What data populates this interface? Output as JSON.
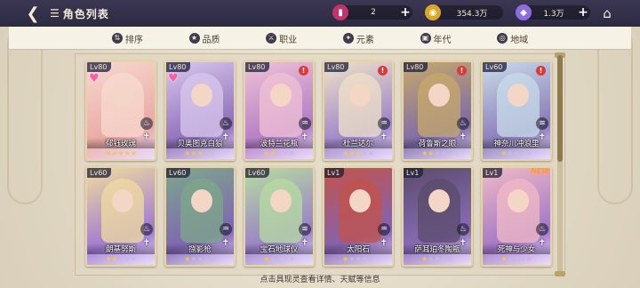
{
  "header": {
    "title": "角色列表",
    "back_icon": "back-arrow-icon",
    "list_icon": "list-icon",
    "home_icon": "home-temple-icon"
  },
  "resources": [
    {
      "icon": "ticket-icon",
      "value": "2",
      "color": "#c0346a"
    },
    {
      "icon": "gold-coin-icon",
      "value": "354.3万",
      "color": "#d9a728"
    },
    {
      "icon": "crystal-icon",
      "value": "1.3万",
      "color": "#8f6be0"
    }
  ],
  "filters": [
    {
      "label": "排序",
      "icon": "sort-icon"
    },
    {
      "label": "品质",
      "icon": "quality-icon"
    },
    {
      "label": "职业",
      "icon": "class-icon"
    },
    {
      "label": "元素",
      "icon": "element-icon"
    },
    {
      "label": "年代",
      "icon": "era-icon"
    },
    {
      "label": "地域",
      "icon": "region-icon"
    }
  ],
  "cards": [
    {
      "level": "Lv80",
      "name": "郁钰玫瑰",
      "heart": true,
      "alert": false,
      "new": false,
      "element": "火",
      "stars": 5,
      "colors": [
        "#e9a9a3",
        "#f7d9d0"
      ]
    },
    {
      "level": "Lv80",
      "name": "贝奥图克白狼",
      "heart": true,
      "alert": false,
      "new": false,
      "element": "火",
      "stars": 3,
      "colors": [
        "#8e6fb8",
        "#d9c8ee"
      ]
    },
    {
      "level": "Lv80",
      "name": "波特兰花瓶",
      "heart": false,
      "alert": true,
      "new": false,
      "element": "水",
      "stars": 2,
      "colors": [
        "#b27cc4",
        "#f0c2d6"
      ]
    },
    {
      "level": "Lv80",
      "name": "杜兰达尔",
      "heart": false,
      "alert": true,
      "new": false,
      "element": "水",
      "stars": 3,
      "colors": [
        "#9d85c8",
        "#efe2c8"
      ]
    },
    {
      "level": "Lv80",
      "name": "荷鲁斯之眼",
      "heart": false,
      "alert": true,
      "new": false,
      "element": "火",
      "stars": 2,
      "colors": [
        "#7e6aa8",
        "#c7a96b"
      ]
    },
    {
      "level": "Lv60",
      "name": "神奈川冲浪里",
      "heart": false,
      "alert": true,
      "new": false,
      "element": "风",
      "stars": 1,
      "colors": [
        "#8a7bb8",
        "#c8dcea"
      ]
    },
    {
      "level": "Lv60",
      "name": "朗基努斯",
      "heart": false,
      "alert": false,
      "new": false,
      "element": "火",
      "stars": 2,
      "colors": [
        "#9f7ad0",
        "#f0dca0"
      ]
    },
    {
      "level": "Lv60",
      "name": "捌影枪",
      "heart": false,
      "alert": false,
      "new": false,
      "element": "水",
      "stars": 1,
      "colors": [
        "#7f66b2",
        "#7ea88a"
      ]
    },
    {
      "level": "Lv60",
      "name": "宝石地球仪",
      "heart": false,
      "alert": false,
      "new": false,
      "element": "风",
      "stars": 1,
      "colors": [
        "#9a80c8",
        "#b7dca0"
      ]
    },
    {
      "level": "Lv1",
      "name": "太阳石",
      "heart": false,
      "alert": false,
      "new": false,
      "element": "水",
      "stars": 1,
      "colors": [
        "#8463b0",
        "#c3534a"
      ]
    },
    {
      "level": "Lv1",
      "name": "萨耳珀冬陶瓶",
      "heart": false,
      "alert": false,
      "new": false,
      "element": "火",
      "stars": 1,
      "colors": [
        "#8a6cb8",
        "#5a4b6a"
      ]
    },
    {
      "level": "Lv1",
      "name": "死神与少女",
      "heart": false,
      "alert": false,
      "new": true,
      "element": "火",
      "stars": 1,
      "colors": [
        "#a178c6",
        "#f1b9c6"
      ]
    }
  ],
  "new_label": "NEW",
  "hint": "点击具现灵查看详情、天赋等信息"
}
